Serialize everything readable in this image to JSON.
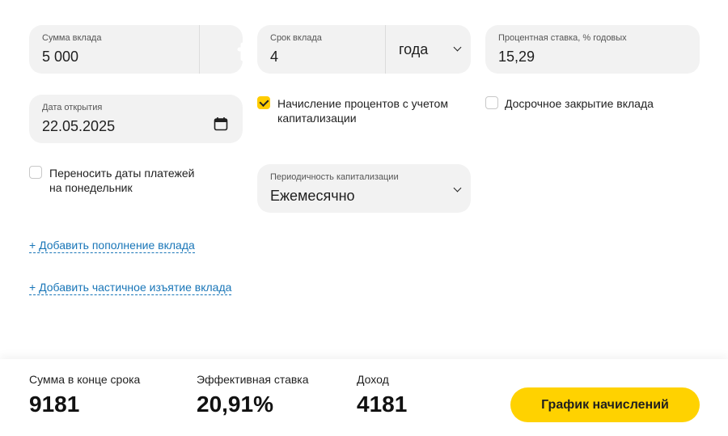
{
  "deposit_amount": {
    "label": "Сумма вклада",
    "value": "5 000"
  },
  "deposit_term": {
    "label": "Срок вклада",
    "value": "4",
    "unit": "года"
  },
  "interest_rate": {
    "label": "Процентная ставка, % годовых",
    "value": "15,29"
  },
  "open_date": {
    "label": "Дата открытия",
    "value": "22.05.2025"
  },
  "capitalization_checkbox": {
    "label": "Начисление процентов с учетом капитализации",
    "checked": true
  },
  "early_close_checkbox": {
    "label": "Досрочное закрытие вклада",
    "checked": false
  },
  "move_dates_checkbox": {
    "label": "Переносить даты платежей на понедельник",
    "checked": false
  },
  "capitalization_period": {
    "label": "Периодичность капитализации",
    "value": "Ежемесячно"
  },
  "links": {
    "add_deposit": "+ Добавить пополнение вклада",
    "add_withdrawal": "+ Добавить частичное изъятие вклада"
  },
  "results": {
    "end_sum_label": "Сумма в конце срока",
    "end_sum_value": "9181",
    "effective_rate_label": "Эффективная ставка",
    "effective_rate_value": "20,91%",
    "income_label": "Доход",
    "income_value": "4181"
  },
  "schedule_button": "График начислений",
  "colors": {
    "accent": "#ffd200",
    "link": "#1976b8",
    "field_bg": "#f2f2f2"
  }
}
